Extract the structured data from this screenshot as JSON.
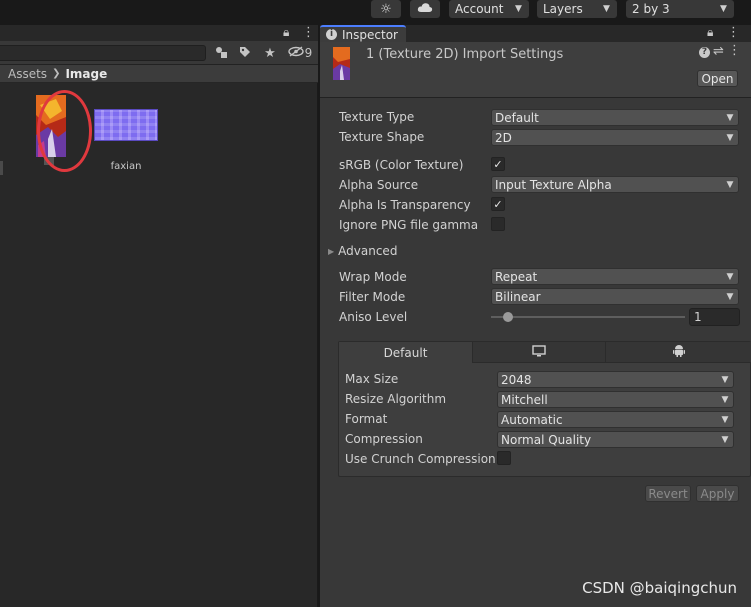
{
  "toolbar": {
    "account_label": "Account",
    "layers_label": "Layers",
    "layout_label": "2 by 3"
  },
  "project": {
    "hidden_count": "9",
    "breadcrumb": {
      "root": "Assets",
      "current": "Image"
    },
    "assets": [
      {
        "name": "",
        "thumb_colors": [
          "#c0301a",
          "#f2a128",
          "#5b3a9c"
        ]
      },
      {
        "name": "faxian",
        "thumb_colors": [
          "#7d6bef",
          "#a99af8"
        ]
      }
    ]
  },
  "inspector": {
    "tab_label": "Inspector",
    "title": "1 (Texture 2D) Import Settings",
    "open_button": "Open",
    "fields": {
      "texture_type": {
        "label": "Texture Type",
        "value": "Default"
      },
      "texture_shape": {
        "label": "Texture Shape",
        "value": "2D"
      },
      "srgb": {
        "label": "sRGB (Color Texture)",
        "checked": true
      },
      "alpha_source": {
        "label": "Alpha Source",
        "value": "Input Texture Alpha"
      },
      "alpha_transparency": {
        "label": "Alpha Is Transparency",
        "checked": true
      },
      "ignore_png_gamma": {
        "label": "Ignore PNG file gamma",
        "checked": false
      },
      "advanced": {
        "label": "Advanced"
      },
      "wrap_mode": {
        "label": "Wrap Mode",
        "value": "Repeat"
      },
      "filter_mode": {
        "label": "Filter Mode",
        "value": "Bilinear"
      },
      "aniso_level": {
        "label": "Aniso Level",
        "value": "1",
        "slider_fraction": 0.0
      }
    },
    "platform": {
      "tabs": [
        {
          "label": "Default",
          "icon": ""
        },
        {
          "label": "",
          "icon": "monitor-icon"
        },
        {
          "label": "",
          "icon": "android-icon"
        }
      ],
      "fields": {
        "max_size": {
          "label": "Max Size",
          "value": "2048"
        },
        "resize_algorithm": {
          "label": "Resize Algorithm",
          "value": "Mitchell"
        },
        "format": {
          "label": "Format",
          "value": "Automatic"
        },
        "compression": {
          "label": "Compression",
          "value": "Normal Quality"
        },
        "crunch": {
          "label": "Use Crunch Compression",
          "checked": false
        }
      }
    },
    "revert_button": "Revert",
    "apply_button": "Apply"
  },
  "check_glyph": "✓",
  "watermark": "CSDN @baiqingchun",
  "colors": {
    "accent": "#4c7eff",
    "selection_circle": "#e0393e"
  }
}
